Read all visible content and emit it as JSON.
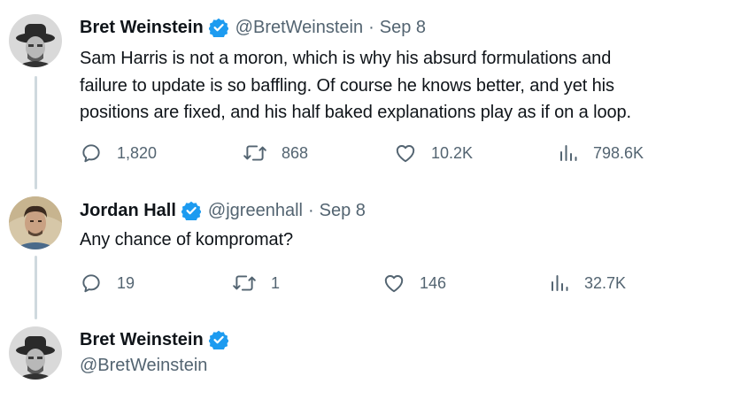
{
  "thread": [
    {
      "display_name": "Bret Weinstein",
      "handle": "@BretWeinstein",
      "separator": "·",
      "date": "Sep 8",
      "text_lines": [
        "Sam Harris is not a moron, which is why his absurd formulations and",
        "failure to update is so baffling. Of course he knows better, and yet his",
        "positions are fixed, and his half baked explanations play as if on a loop."
      ],
      "replies": "1,820",
      "reposts": "868",
      "likes": "10.2K",
      "views": "798.6K"
    },
    {
      "display_name": "Jordan Hall",
      "handle": "@jgreenhall",
      "separator": "·",
      "date": "Sep 8",
      "text_lines": [
        "Any chance of kompromat?"
      ],
      "replies": "19",
      "reposts": "1",
      "likes": "146",
      "views": "32.7K"
    },
    {
      "display_name": "Bret Weinstein",
      "handle": "@BretWeinstein"
    }
  ],
  "icons": {
    "reply": "reply-icon",
    "repost": "repost-icon",
    "like": "heart-icon",
    "views": "views-icon",
    "verified": "verified-badge-icon"
  },
  "colors": {
    "text_primary": "#0f1419",
    "text_secondary": "#536471",
    "verified_blue": "#1d9bf0",
    "thread_line": "#cfd9de"
  }
}
